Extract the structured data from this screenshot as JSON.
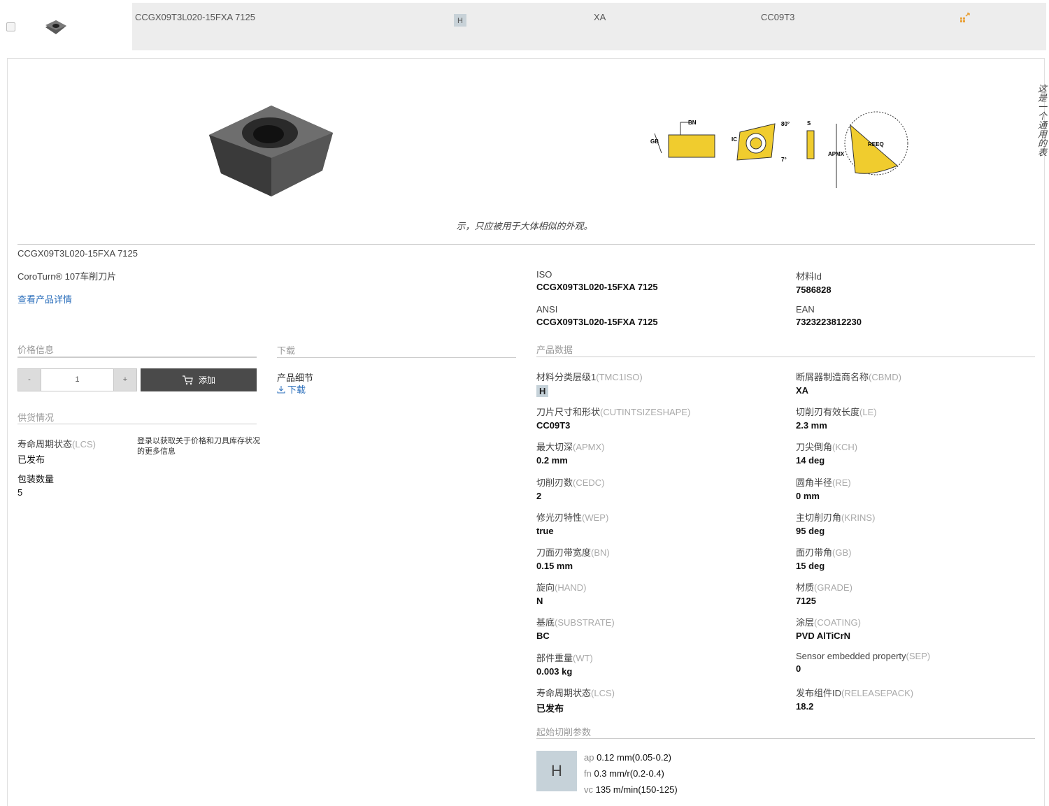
{
  "row": {
    "name": "CCGX09T3L020-15FXA 7125",
    "material_badge": "H",
    "chipbreaker": "XA",
    "size_shape": "CC09T3"
  },
  "detail": {
    "vertical_note": "这是一个通用的表",
    "note_continuation": "示，只应被用于大体相似的外观。",
    "product_name": "CCGX09T3L020-15FXA 7125",
    "family": "CoroTurn® 107车削刀片",
    "view_details": "查看产品详情",
    "iso_label": "ISO",
    "iso_value": "CCGX09T3L020-15FXA 7125",
    "ansi_label": "ANSI",
    "ansi_value": "CCGX09T3L020-15FXA 7125",
    "material_id_label": "材料Id",
    "material_id_value": "7586828",
    "ean_label": "EAN",
    "ean_value": "7323223812230",
    "price_title": "价格信息",
    "qty_minus": "-",
    "qty_value": "1",
    "qty_plus": "+",
    "add_label": "添加",
    "stock_title": "供货情况",
    "lcs_label": "寿命周期状态",
    "lcs_code": "(LCS)",
    "lcs_value": "已发布",
    "login_note": "登录以获取关于价格和刀具库存状况的更多信息",
    "pack_label": "包装数量",
    "pack_value": "5",
    "download_title": "下载",
    "product_detail": "产品细节",
    "download_link": "下载",
    "product_data_title": "产品数据",
    "product_data": [
      {
        "label": "材料分类层级1",
        "code": "(TMC1ISO)",
        "value": "H",
        "badge": true
      },
      {
        "label": "断屑器制造商名称",
        "code": "(CBMD)",
        "value": "XA"
      },
      {
        "label": "刀片尺寸和形状",
        "code": "(CUTINTSIZESHAPE)",
        "value": "CC09T3"
      },
      {
        "label": "切削刃有效长度",
        "code": "(LE)",
        "value": "2.3 mm"
      },
      {
        "label": "最大切深",
        "code": "(APMX)",
        "value": "0.2 mm"
      },
      {
        "label": "刀尖倒角",
        "code": "(KCH)",
        "value": "14 deg"
      },
      {
        "label": "切削刃数",
        "code": "(CEDC)",
        "value": "2"
      },
      {
        "label": "圆角半径",
        "code": "(RE)",
        "value": "0 mm"
      },
      {
        "label": "修光刃特性",
        "code": "(WEP)",
        "value": "true"
      },
      {
        "label": "主切削刃角",
        "code": "(KRINS)",
        "value": "95 deg"
      },
      {
        "label": "刀面刃带宽度",
        "code": "(BN)",
        "value": "0.15 mm"
      },
      {
        "label": "面刃带角",
        "code": "(GB)",
        "value": "15 deg"
      },
      {
        "label": "旋向",
        "code": "(HAND)",
        "value": "N"
      },
      {
        "label": "材质",
        "code": "(GRADE)",
        "value": "7125"
      },
      {
        "label": "基底",
        "code": "(SUBSTRATE)",
        "value": "BC"
      },
      {
        "label": "涂层",
        "code": "(COATING)",
        "value": "PVD AlTiCrN"
      },
      {
        "label": "部件重量",
        "code": "(WT)",
        "value": "0.003 kg"
      },
      {
        "label": "Sensor embedded property",
        "code": "(SEP)",
        "value": "0"
      },
      {
        "label": "寿命周期状态",
        "code": "(LCS)",
        "value": "已发布"
      },
      {
        "label": "发布组件ID",
        "code": "(RELEASEPACK)",
        "value": "18.2"
      }
    ],
    "cutting_title": "起始切削参数",
    "cutting_badge": "H",
    "cutting": [
      {
        "k": "ap",
        "v": "0.12 mm(0.05-0.2)"
      },
      {
        "k": "fn",
        "v": "0.3 mm/r(0.2-0.4)"
      },
      {
        "k": "vc",
        "v": "135 m/min(150-125)"
      }
    ],
    "diagram_labels": {
      "bn": "BN",
      "gb": "GB",
      "ic": "IC",
      "ang80": "80°",
      "s": "S",
      "ang7": "7°",
      "apmx": "APMX",
      "reeq": "REEQ"
    }
  },
  "colors": {
    "insert_yellow": "#f0cc2e",
    "link_blue": "#2a6ebb",
    "compare_orange": "#e8a13a"
  }
}
